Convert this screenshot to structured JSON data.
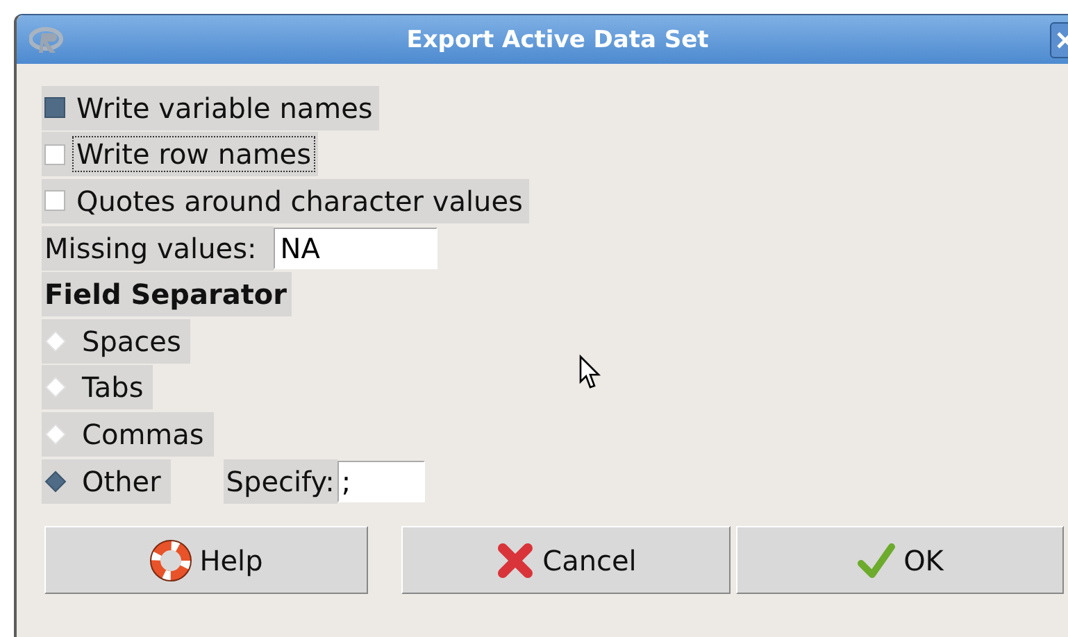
{
  "window": {
    "title": "Export Active Data Set"
  },
  "checkboxes": [
    {
      "label": "Write variable names",
      "checked": true,
      "focused": false
    },
    {
      "label": "Write row names",
      "checked": false,
      "focused": true
    },
    {
      "label": "Quotes around character values",
      "checked": false,
      "focused": false
    }
  ],
  "missing_values": {
    "label": "Missing values:",
    "value": "NA"
  },
  "field_separator": {
    "heading": "Field Separator",
    "options": [
      {
        "label": "Spaces",
        "selected": false
      },
      {
        "label": "Tabs",
        "selected": false
      },
      {
        "label": "Commas",
        "selected": false
      },
      {
        "label": "Other",
        "selected": true
      }
    ],
    "specify": {
      "label": "Specify:",
      "value": ";"
    }
  },
  "buttons": [
    {
      "kind": "help",
      "label": "Help"
    },
    {
      "kind": "cancel",
      "label": "Cancel"
    },
    {
      "kind": "ok",
      "label": "OK"
    }
  ]
}
